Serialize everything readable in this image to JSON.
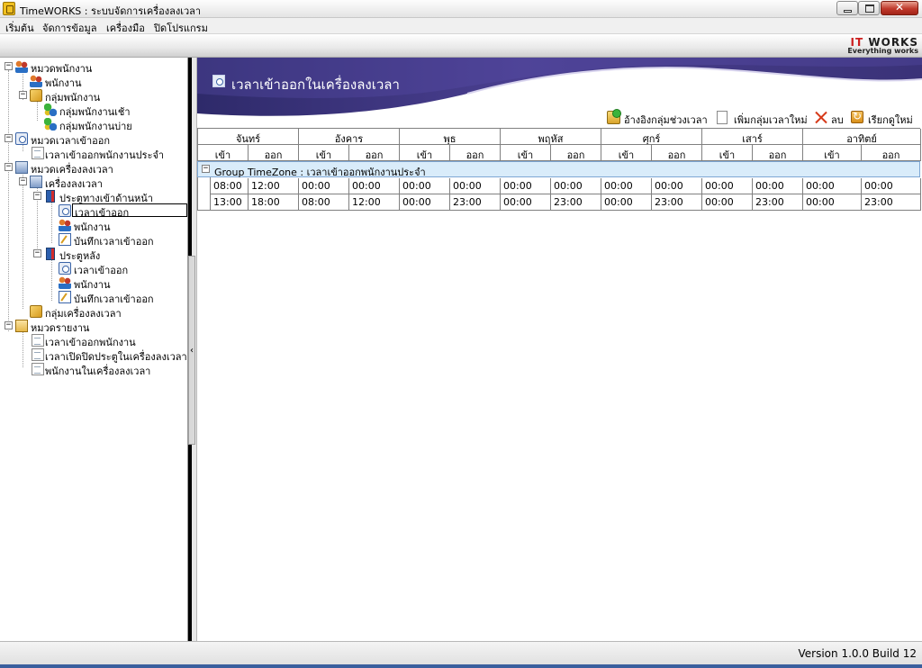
{
  "window": {
    "title": "TimeWORKS : ระบบจัดการเครื่องลงเวลา"
  },
  "menu": {
    "items": [
      "เริ่มต้น",
      "จัดการข้อมูล",
      "เครื่องมือ",
      "ปิดโปรแกรม"
    ]
  },
  "brand": {
    "name_part1": "IT ",
    "name_part2": "WORKS",
    "tagline": "Everything works"
  },
  "tree": {
    "nodes": [
      {
        "label": "หมวดพนักงาน",
        "icon": "users-icon"
      },
      {
        "label": "พนักงาน",
        "icon": "users-icon"
      },
      {
        "label": "กลุ่มพนักงาน",
        "icon": "group-icon"
      },
      {
        "label": "กลุ่มพนักงานเช้า",
        "icon": "cubes-icon"
      },
      {
        "label": "กลุ่มพนักงานบ่าย",
        "icon": "cubes-icon"
      },
      {
        "label": "หมวดเวลาเข้าออก",
        "icon": "clock-icon"
      },
      {
        "label": "เวลาเข้าออกพนักงานประจำ",
        "icon": "document-icon"
      },
      {
        "label": "หมวดเครื่องลงเวลา",
        "icon": "machine-icon"
      },
      {
        "label": "เครื่องลงเวลา",
        "icon": "machine-icon"
      },
      {
        "label": "ประตูทางเข้าด้านหน้า",
        "icon": "door-icon"
      },
      {
        "label": "เวลาเข้าออก",
        "icon": "clock-icon"
      },
      {
        "label": "พนักงาน",
        "icon": "users-icon"
      },
      {
        "label": "บันทึกเวลาเข้าออก",
        "icon": "edit-icon"
      },
      {
        "label": "ประตูหลัง",
        "icon": "door-icon"
      },
      {
        "label": "เวลาเข้าออก",
        "icon": "clock-icon"
      },
      {
        "label": "พนักงาน",
        "icon": "users-icon"
      },
      {
        "label": "บันทึกเวลาเข้าออก",
        "icon": "edit-icon"
      },
      {
        "label": "กลุ่มเครื่องลงเวลา",
        "icon": "group-icon"
      },
      {
        "label": "หมวดรายงาน",
        "icon": "report-icon"
      },
      {
        "label": "เวลาเข้าออกพนักงาน",
        "icon": "document-icon"
      },
      {
        "label": "เวลาเปิดปิดประตูในเครื่องลงเวลา",
        "icon": "document-icon"
      },
      {
        "label": "พนักงานในเครื่องลงเวลา",
        "icon": "document-icon"
      }
    ],
    "selected_index": 10
  },
  "banner": {
    "title": "เวลาเข้าออกในเครื่องลงเวลา"
  },
  "toolbar": {
    "ref_label": "อ้างอิงกลุ่มช่วงเวลา",
    "add_label": "เพิ่มกลุ่มเวลาใหม่",
    "delete_label": "ลบ",
    "refresh_label": "เรียกดูใหม่"
  },
  "grid": {
    "days": [
      "จันทร์",
      "อังคาร",
      "พุธ",
      "พฤหัส",
      "ศุกร์",
      "เสาร์",
      "อาทิตย์"
    ],
    "in_label": "เข้า",
    "out_label": "ออก",
    "group_label": "Group TimeZone : เวลาเข้าออกพนักงานประจำ",
    "rows": [
      [
        "08:00",
        "12:00",
        "00:00",
        "00:00",
        "00:00",
        "00:00",
        "00:00",
        "00:00",
        "00:00",
        "00:00",
        "00:00",
        "00:00",
        "00:00",
        "00:00"
      ],
      [
        "13:00",
        "18:00",
        "08:00",
        "12:00",
        "00:00",
        "23:00",
        "00:00",
        "23:00",
        "00:00",
        "23:00",
        "00:00",
        "23:00",
        "00:00",
        "23:00"
      ]
    ]
  },
  "status": {
    "version": "Version 1.0.0 Build 12"
  }
}
